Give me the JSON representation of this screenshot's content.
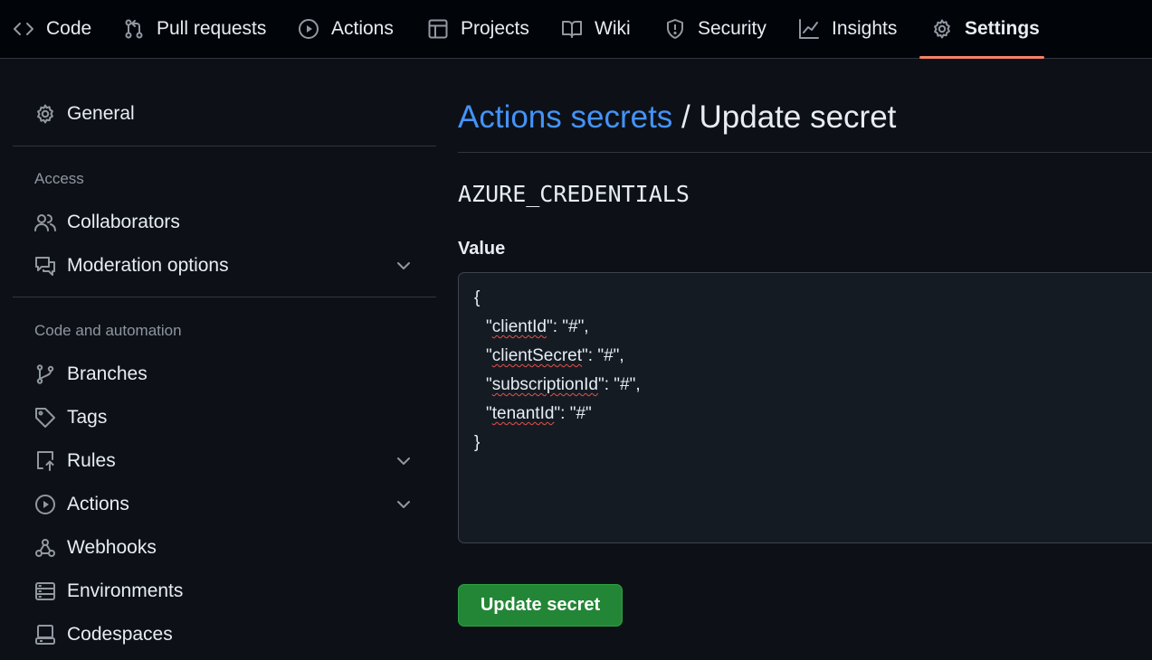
{
  "topnav": {
    "tabs": [
      {
        "label": "Code",
        "icon": "code-icon"
      },
      {
        "label": "Pull requests",
        "icon": "git-pull-request-icon"
      },
      {
        "label": "Actions",
        "icon": "play-icon"
      },
      {
        "label": "Projects",
        "icon": "table-icon"
      },
      {
        "label": "Wiki",
        "icon": "book-icon"
      },
      {
        "label": "Security",
        "icon": "shield-icon"
      },
      {
        "label": "Insights",
        "icon": "graph-icon"
      },
      {
        "label": "Settings",
        "icon": "gear-icon",
        "active": true
      }
    ]
  },
  "sidebar": {
    "general": "General",
    "access_heading": "Access",
    "collaborators": "Collaborators",
    "moderation": "Moderation options",
    "code_heading": "Code and automation",
    "branches": "Branches",
    "tags": "Tags",
    "rules": "Rules",
    "actions": "Actions",
    "webhooks": "Webhooks",
    "environments": "Environments",
    "codespaces": "Codespaces"
  },
  "main": {
    "breadcrumb_link": "Actions secrets",
    "breadcrumb_sep": " / ",
    "title": "Update secret",
    "secret_name": "AZURE_CREDENTIALS",
    "value_label": "Value",
    "value": {
      "open": "{",
      "l1_q": "\"",
      "l1_key": "clientId",
      "l1_rest": "\": \"#\",",
      "l2_q": "\"",
      "l2_key": "clientSecret",
      "l2_rest": "\": \"#\",",
      "l3_q": "\"",
      "l3_key": "subscriptionId",
      "l3_rest": "\": \"#\",",
      "l4_q": "\"",
      "l4_key": "tenantId",
      "l4_rest": "\": \"#\"",
      "close": "}"
    },
    "submit_label": "Update secret"
  },
  "colors": {
    "background": "#0d1117",
    "nav_background": "#010409",
    "link": "#4493f8",
    "active_underline": "#f78166",
    "primary_button": "#238636"
  }
}
